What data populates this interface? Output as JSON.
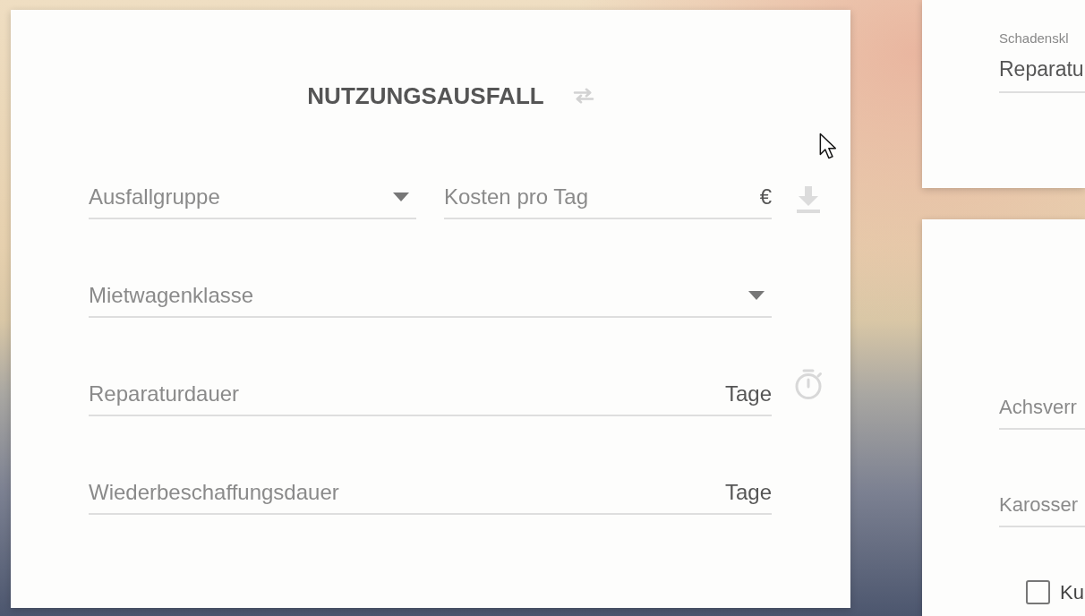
{
  "main_card": {
    "title": "NUTZUNGSAUSFALL",
    "rows": [
      {
        "fields": [
          {
            "kind": "select",
            "placeholder": "Ausfallgruppe"
          },
          {
            "kind": "input",
            "placeholder": "Kosten pro Tag",
            "suffix": "€"
          }
        ]
      },
      {
        "fields": [
          {
            "kind": "select",
            "placeholder": "Mietwagenklasse"
          }
        ]
      },
      {
        "fields": [
          {
            "kind": "input",
            "placeholder": "Reparaturdauer",
            "suffix": "Tage"
          }
        ]
      },
      {
        "fields": [
          {
            "kind": "input",
            "placeholder": "Wiederbeschaffungsdauer",
            "suffix": "Tage"
          }
        ]
      }
    ]
  },
  "side_cards": [
    {
      "fields": [
        {
          "kind": "filled",
          "label": "Schadenskl",
          "value": "Reparatu"
        }
      ]
    },
    {
      "fields": [
        {
          "kind": "input",
          "placeholder": "Achsverr"
        },
        {
          "kind": "input",
          "placeholder": "Karosser"
        }
      ],
      "checkbox": {
        "label": "Ku",
        "checked": false
      }
    }
  ]
}
